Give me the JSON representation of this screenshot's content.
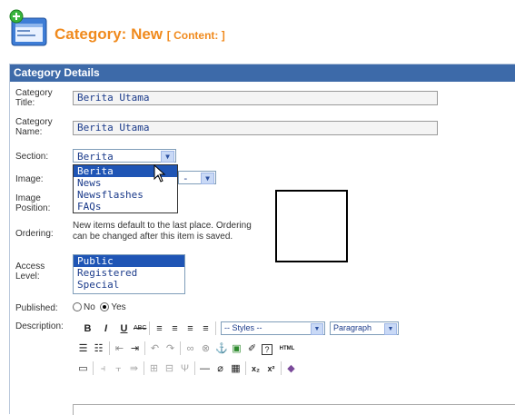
{
  "header": {
    "title": "Category: New",
    "subtitle": "[ Content: ]"
  },
  "panel": {
    "title": "Category Details"
  },
  "labels": {
    "category_title_1": "Category",
    "category_title_2": "Title:",
    "category_name_1": "Category",
    "category_name_2": "Name:",
    "section": "Section:",
    "image": "Image:",
    "image_position_1": "Image",
    "image_position_2": "Position:",
    "ordering": "Ordering:",
    "access_1": "Access",
    "access_2": "Level:",
    "published": "Published:",
    "description": "Description:"
  },
  "fields": {
    "category_title": "Berita Utama",
    "category_name": "Berita Utama"
  },
  "section_select": {
    "value": "Berita",
    "options": [
      "Berita",
      "News",
      "Newsflashes",
      "FAQs"
    ],
    "highlighted": "Berita"
  },
  "image_select": {
    "value": "-"
  },
  "ordering_note": {
    "line1": "New items default to the last place. Ordering",
    "line2": "can be changed after this item is saved."
  },
  "access": {
    "options": [
      "Public",
      "Registered",
      "Special"
    ],
    "selected": "Public"
  },
  "published": {
    "no": "No",
    "yes": "Yes",
    "value": "Yes"
  },
  "toolbar": {
    "styles": "-- Styles --",
    "format": "Paragraph"
  }
}
